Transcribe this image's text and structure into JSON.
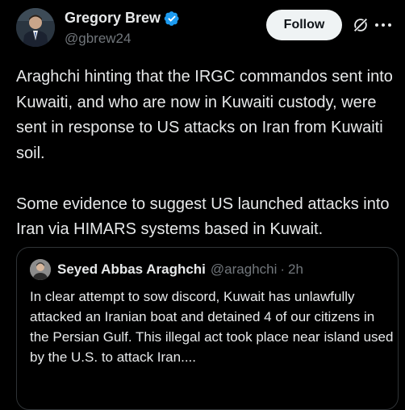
{
  "author": {
    "display_name": "Gregory Brew",
    "handle": "@gbrew24",
    "verified": true,
    "avatar_icon": "profile-photo-man-in-suit"
  },
  "actions": {
    "follow_label": "Follow",
    "grok_icon": "grok-icon",
    "more_icon": "more-horizontal-icon"
  },
  "tweet": {
    "text": "Araghchi hinting that the IRGC commandos sent into Kuwaiti, and who are now in Kuwaiti custody, were sent in response to US attacks on Iran from Kuwaiti soil.\n\nSome evidence to suggest US launched attacks into Iran via HIMARS systems based in Kuwait."
  },
  "quote": {
    "display_name": "Seyed Abbas Araghchi",
    "handle": "@araghchi",
    "separator": "·",
    "time": "2h",
    "text": "In clear attempt to sow discord, Kuwait has unlawfully attacked an Iranian boat and detained 4 of our citizens in the Persian Gulf. This illegal act took place near island used by the U.S. to attack Iran...."
  },
  "colors": {
    "background": "#000000",
    "text": "#e7e9ea",
    "muted": "#71767b",
    "verified_blue": "#1d9bf0",
    "border": "#2f3336"
  }
}
